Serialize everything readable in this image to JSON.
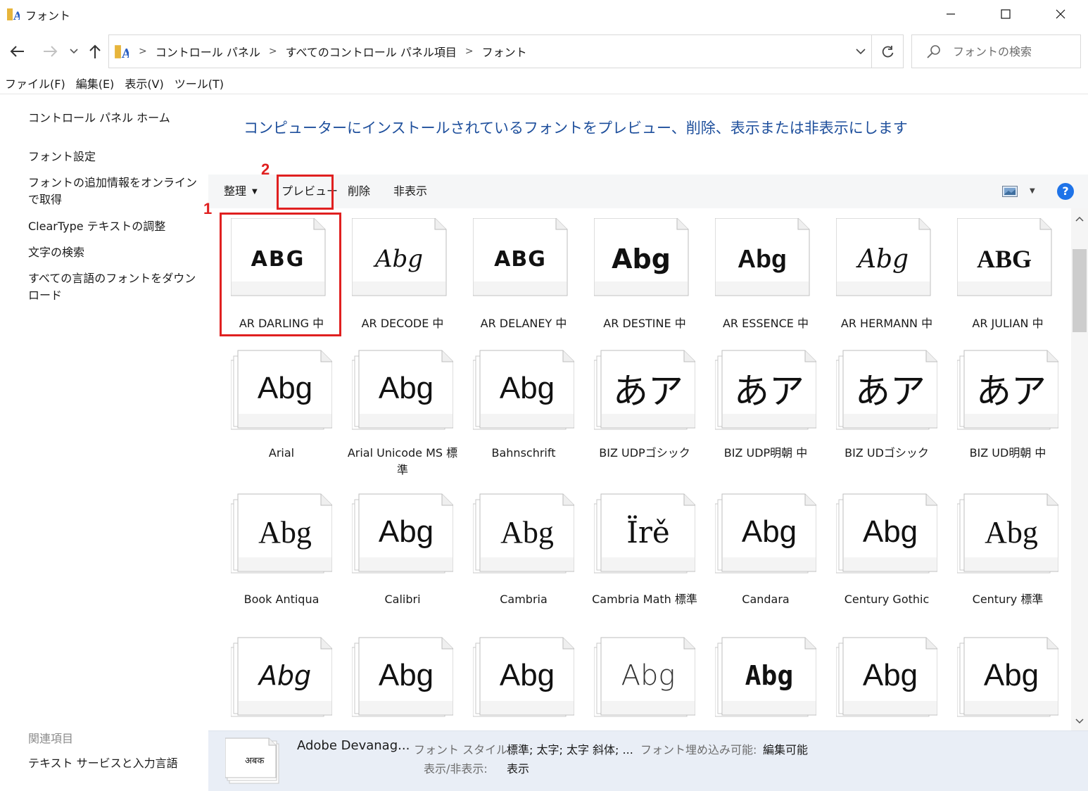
{
  "window": {
    "title": "フォント"
  },
  "address": {
    "crumbs": [
      "コントロール パネル",
      "すべてのコントロール パネル項目",
      "フォント"
    ]
  },
  "search": {
    "placeholder": "フォントの検索"
  },
  "menubar": {
    "items": [
      "ファイル(F)",
      "編集(E)",
      "表示(V)",
      "ツール(T)"
    ]
  },
  "sidebar": {
    "items": [
      "コントロール パネル ホーム",
      "フォント設定",
      "フォントの追加情報をオンラインで取得",
      "ClearType テキストの調整",
      "文字の検索",
      "すべての言語のフォントをダウンロード"
    ],
    "related_header": "関連項目",
    "related_items": [
      "テキスト サービスと入力言語"
    ]
  },
  "heading": "コンピューターにインストールされているフォントをプレビュー、削除、表示または非表示にします",
  "toolbar": {
    "organize": "整理",
    "preview": "プレビュー",
    "delete": "削除",
    "hide": "非表示",
    "help": "?"
  },
  "callouts": [
    "1",
    "2"
  ],
  "fonts": [
    {
      "name": "AR DARLING 中",
      "sample": "ABG"
    },
    {
      "name": "AR DECODE 中",
      "sample": "Abg"
    },
    {
      "name": "AR DELANEY 中",
      "sample": "ABG"
    },
    {
      "name": "AR DESTINE 中",
      "sample": "Abg"
    },
    {
      "name": "AR ESSENCE 中",
      "sample": "Abg"
    },
    {
      "name": "AR HERMANN 中",
      "sample": "Abg"
    },
    {
      "name": "AR JULIAN 中",
      "sample": "ABG"
    },
    {
      "name": "Arial",
      "sample": "Abg"
    },
    {
      "name": "Arial Unicode MS 標準",
      "sample": "Abg"
    },
    {
      "name": "Bahnschrift",
      "sample": "Abg"
    },
    {
      "name": "BIZ UDPゴシック",
      "sample": "あア"
    },
    {
      "name": "BIZ UDP明朝 中",
      "sample": "あア"
    },
    {
      "name": "BIZ UDゴシック",
      "sample": "あア"
    },
    {
      "name": "BIZ UD明朝 中",
      "sample": "あア"
    },
    {
      "name": "Book Antiqua",
      "sample": "Abg"
    },
    {
      "name": "Calibri",
      "sample": "Abg"
    },
    {
      "name": "Cambria",
      "sample": "Abg"
    },
    {
      "name": "Cambria Math 標準",
      "sample": "Ïrě"
    },
    {
      "name": "Candara",
      "sample": "Abg"
    },
    {
      "name": "Century Gothic",
      "sample": "Abg"
    },
    {
      "name": "Century 標準",
      "sample": "Abg"
    },
    {
      "name": "",
      "sample": "Abg"
    },
    {
      "name": "",
      "sample": "Abg"
    },
    {
      "name": "",
      "sample": "Abg"
    },
    {
      "name": "",
      "sample": "Abg"
    },
    {
      "name": "",
      "sample": "Abg"
    },
    {
      "name": "",
      "sample": "Abg"
    },
    {
      "name": "",
      "sample": "Abg"
    }
  ],
  "details": {
    "name": "Adobe Devanag...",
    "sample": "अबक",
    "style_label": "フォント スタイル:",
    "style_value": "標準; 太字; 太字 斜体; ...",
    "embed_label": "フォント埋め込み可能:",
    "embed_value": "編集可能",
    "visibility_label": "表示/非表示:",
    "visibility_value": "表示"
  },
  "colors": {
    "heading": "#1e4f9c",
    "highlight": "#e02020",
    "help": "#1e73e8",
    "details_bg": "#e9eef6"
  }
}
